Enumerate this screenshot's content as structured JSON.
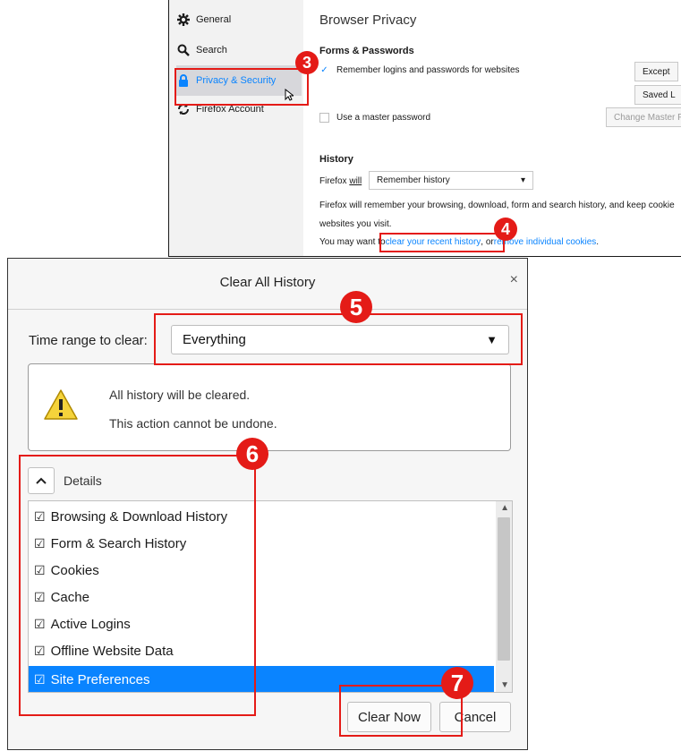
{
  "settings": {
    "nav": [
      {
        "label": "General",
        "icon": "gear-icon"
      },
      {
        "label": "Search",
        "icon": "search-icon"
      },
      {
        "label": "Privacy & Security",
        "icon": "lock-icon"
      },
      {
        "label": "Firefox Account",
        "icon": "sync-icon"
      }
    ],
    "page_title": "Browser Privacy",
    "forms_heading": "Forms & Passwords",
    "remember_logins": "Remember logins and passwords for websites",
    "exceptions_button": "Except",
    "saved_logins_button": "Saved L",
    "master_password": "Use a master password",
    "change_master_button": "Change Master Pa",
    "history_heading": "History",
    "firefox_will_prefix": "Firefox ",
    "firefox_will_word": "will",
    "history_mode": "Remember history",
    "history_desc_line1": "Firefox will remember your browsing, download, form and search history, and keep cookie",
    "history_desc_line2": "websites you visit.",
    "clear_prefix": "You may want to ",
    "clear_link": "clear your recent history",
    "clear_mid": ", or ",
    "remove_link": "remove individual cookies",
    "clear_suffix": "."
  },
  "dialog": {
    "title": "Clear All History",
    "close": "×",
    "time_range_label": "Time range to clear:",
    "time_range_value": "Everything",
    "warning_line1": "All history will be cleared.",
    "warning_line2": "This action cannot be undone.",
    "details_label": "Details",
    "items": [
      {
        "label": "Browsing & Download History",
        "checked": true
      },
      {
        "label": "Form & Search History",
        "checked": true
      },
      {
        "label": "Cookies",
        "checked": true
      },
      {
        "label": "Cache",
        "checked": true
      },
      {
        "label": "Active Logins",
        "checked": true
      },
      {
        "label": "Offline Website Data",
        "checked": true
      },
      {
        "label": "Site Preferences",
        "checked": true,
        "selected": true
      }
    ],
    "clear_now": "Clear Now",
    "cancel": "Cancel"
  },
  "callouts": [
    "3",
    "4",
    "5",
    "6",
    "7"
  ],
  "colors": {
    "accent": "#0a84ff",
    "callout": "#e41b17",
    "selected_row": "#0a84ff"
  }
}
